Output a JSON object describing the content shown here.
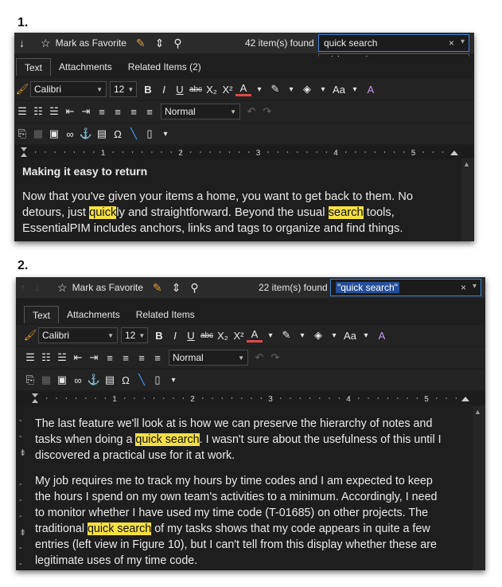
{
  "step1": {
    "label": "1.",
    "toolbar": {
      "favorite_label": "Mark as Favorite",
      "found_text": "42 item(s) found"
    },
    "search": {
      "value": "quick search",
      "suggestion": "quick search"
    },
    "tabs": [
      "Text",
      "Attachments",
      "Related Items  (2)"
    ],
    "format": {
      "font": "Calibri",
      "size": "12",
      "style": "Normal"
    },
    "doc": {
      "heading": "Making it easy to return",
      "p1_a": "Now that you've given your items a home, you want to get back to them. No",
      "p1_b1": "detours, just ",
      "p1_hl1": "quick",
      "p1_b2": "ly and straightforward. Beyond the usual ",
      "p1_hl2": "search",
      "p1_b3": " tools,",
      "p1_c": "EssentialPIM includes anchors, links and tags to organize and find things."
    }
  },
  "step2": {
    "label": "2.",
    "toolbar": {
      "favorite_label": "Mark as Favorite",
      "found_text": "22 item(s) found"
    },
    "search": {
      "value": "\"quick search\""
    },
    "tabs": [
      "Text",
      "Attachments",
      "Related Items"
    ],
    "format": {
      "font": "Calibri",
      "size": "12",
      "style": "Normal"
    },
    "doc": {
      "p1_a": "The last feature we'll look at is how we can preserve the hierarchy of notes and",
      "p1_b1": "tasks when doing a ",
      "p1_hl": "quick search",
      "p1_b2": ". I wasn't sure about the usefulness of this until I",
      "p1_c": "discovered a practical use for it at work.",
      "p2_a": "My job requires me to track my hours by time codes and I am expected to keep",
      "p2_b": "the hours I spend on my own team's activities to a minimum. Accordingly, I need",
      "p2_c": "to monitor whether I have used my time code (T-01685) on other projects. The",
      "p2_d1": "traditional ",
      "p2_hl": "quick search",
      "p2_d2": " of my tasks shows that my code appears in quite a few",
      "p2_e": "entries (left view in Figure 10), but I can't tell from this display whether these are",
      "p2_f": "legitimate uses of my time code."
    }
  },
  "ruler_numbers": [
    "1",
    "2",
    "3",
    "4",
    "5"
  ],
  "colors": {
    "highlight": "#f5e043",
    "panel_bg": "#1e1e1e",
    "focus_border": "#3f7fd6"
  }
}
